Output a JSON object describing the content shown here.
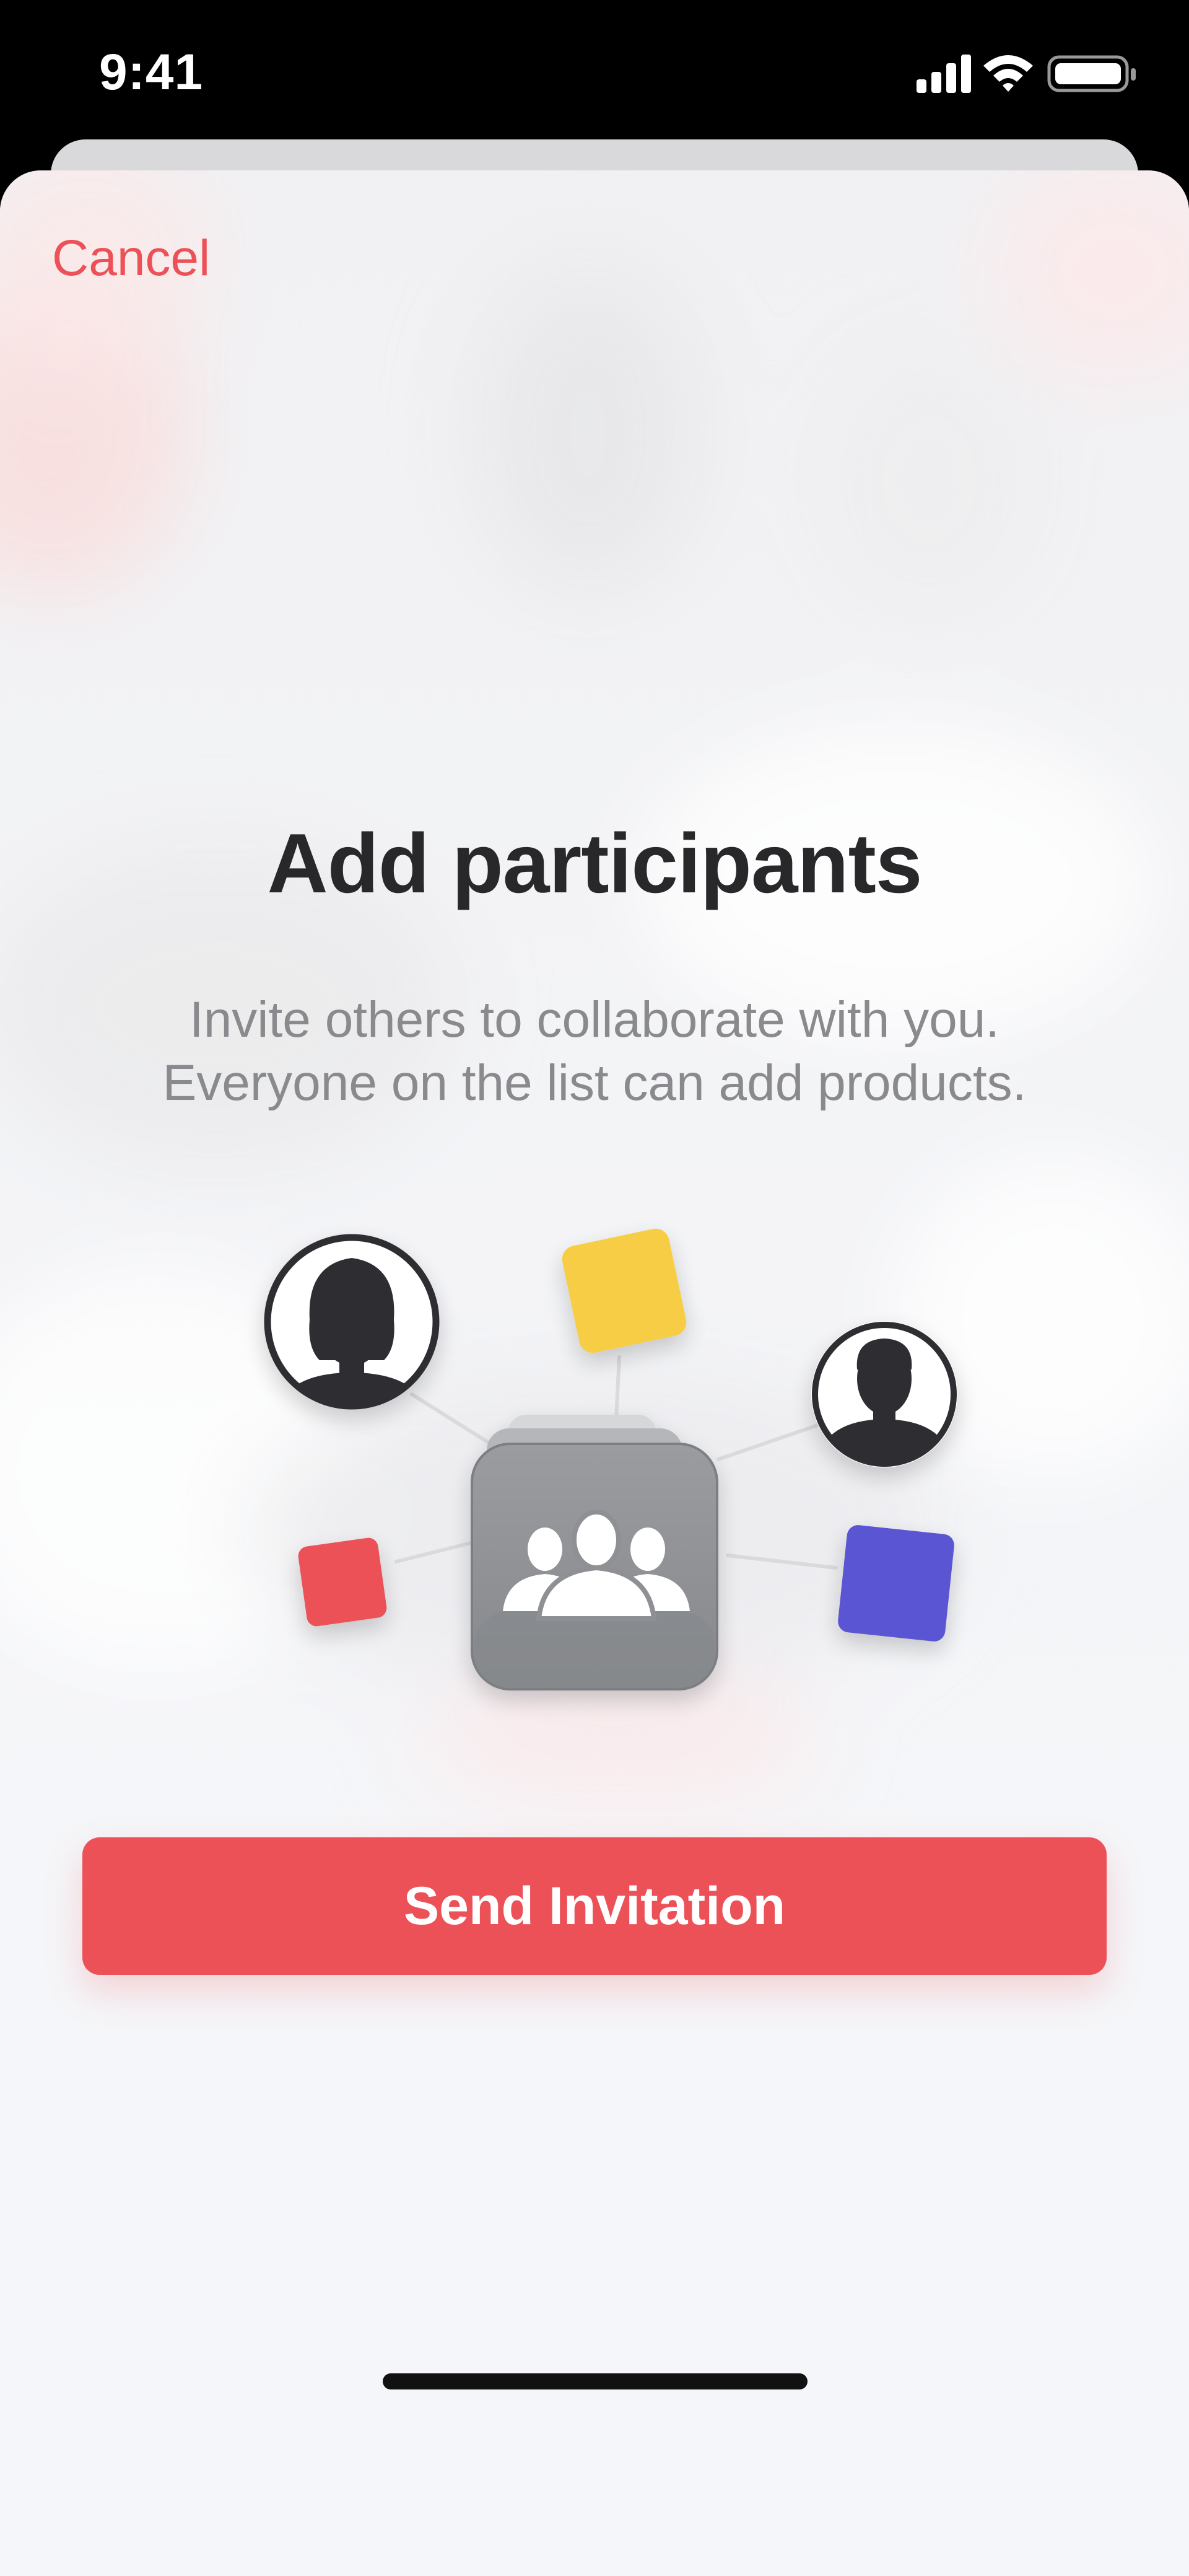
{
  "status_bar": {
    "time": "9:41",
    "icons": [
      "cellular-signal-icon",
      "wifi-icon",
      "battery-icon"
    ]
  },
  "sheet": {
    "cancel_label": "Cancel",
    "title": "Add participants",
    "subtitle_lines": [
      "Invite others to collaborate with you.",
      "Everyone on the list can add products."
    ],
    "illustration_icons": [
      "woman-avatar-icon",
      "man-avatar-icon",
      "group-icon",
      "yellow-square-icon",
      "red-square-icon",
      "blue-square-icon"
    ],
    "send_button_label": "Send Invitation"
  },
  "colors": {
    "accent": "#ec5158",
    "title": "#28282b",
    "subtitle": "#8a8a8e",
    "group_tile": "#8e9094",
    "yellow": "#f6cd45",
    "red": "#ec5158",
    "blue": "#5a56d3",
    "avatar_dark": "#2e2f33"
  }
}
